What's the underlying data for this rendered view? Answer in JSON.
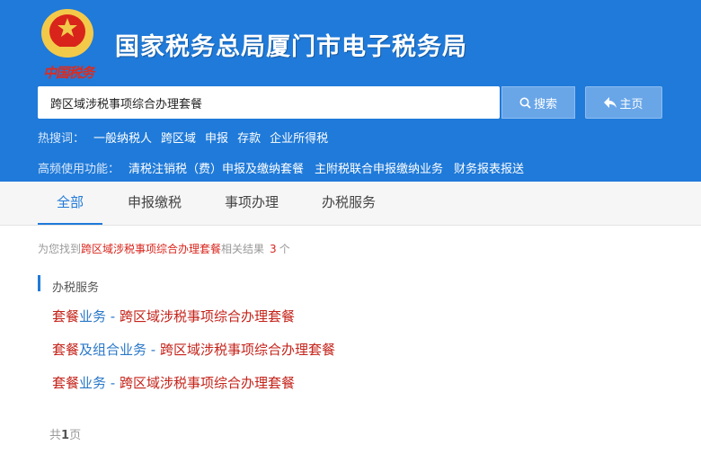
{
  "header": {
    "brand": "中国税务",
    "title": "国家税务总局厦门市电子税务局",
    "emblem_icon": "tax-emblem-icon",
    "colors": {
      "background": "#1f7ad9",
      "button": "#69a6e8",
      "accent_red": "#d8241b"
    }
  },
  "search": {
    "value": "跨区域涉税事项综合办理套餐",
    "button_label": "搜索",
    "button_icon": "search-icon",
    "home_label": "主页",
    "home_icon": "home-arrow-icon"
  },
  "hot_search": {
    "label": "热搜词：",
    "items": [
      "一般纳税人",
      "跨区域",
      "申报",
      "存款",
      "企业所得税"
    ]
  },
  "frequent": {
    "label": "高频使用功能：",
    "items": [
      "清税注销税（费）申报及缴纳套餐",
      "主附税联合申报缴纳业务",
      "财务报表报送"
    ]
  },
  "tabs": [
    "全部",
    "申报缴税",
    "事项办理",
    "办税服务"
  ],
  "active_tab": "全部",
  "summary": {
    "prefix": "为您找到",
    "keyword": "跨区域涉税事项综合办理套餐",
    "middle": "相关结果",
    "count": "3",
    "suffix": "个"
  },
  "section": {
    "title": "办税服务"
  },
  "results": [
    {
      "parts": [
        {
          "text": "套餐",
          "hl": true
        },
        {
          "text": "业务",
          "hl": false
        },
        {
          "text": " - ",
          "hl": false
        },
        {
          "text": "跨区域涉税事项综合办理套餐",
          "hl": true
        }
      ]
    },
    {
      "parts": [
        {
          "text": "套餐",
          "hl": true
        },
        {
          "text": "及组合业务",
          "hl": false
        },
        {
          "text": " - ",
          "hl": false
        },
        {
          "text": "跨区域涉税事项综合办理套餐",
          "hl": true
        }
      ]
    },
    {
      "parts": [
        {
          "text": "套餐",
          "hl": true
        },
        {
          "text": "业务",
          "hl": false
        },
        {
          "text": " - ",
          "hl": false
        },
        {
          "text": "跨区域涉税事项综合办理套餐",
          "hl": true
        }
      ]
    }
  ],
  "pager": {
    "prefix": "共",
    "pages": "1",
    "suffix": "页"
  }
}
